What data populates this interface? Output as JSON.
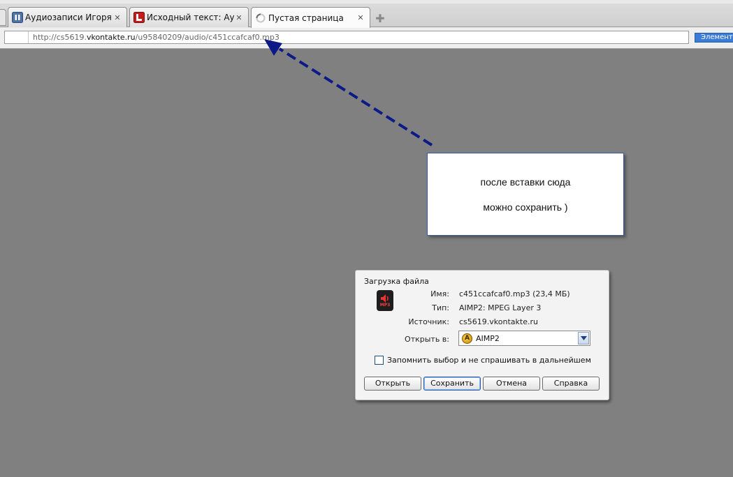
{
  "browser": {
    "tabs": [
      {
        "title": "Аудиозаписи Игоря Пр…",
        "icon": "vk-audio-icon",
        "close": "✕"
      },
      {
        "title": "Исходный текст: Ауди…",
        "icon": "liveinternet-icon",
        "close": "✕"
      },
      {
        "title": "Пустая страница",
        "icon": "loading-spinner-icon",
        "close": "✕"
      }
    ],
    "new_tab": "✚",
    "address": {
      "prefix": "http://cs5619.",
      "domain": "vkontakte.ru",
      "path": "/u95840209/audio/c451ccafcaf0.mp3"
    },
    "panel_button": "Элементы"
  },
  "annotation": {
    "line1": "после вставки сюда",
    "line2": "можно сохранить )",
    "arrow_color": "#0b1a86"
  },
  "dialog": {
    "title": "Загрузка файла",
    "file_icon_label": "MP3",
    "name_label": "Имя:",
    "name_value": "c451ccafcaf0.mp3 (23,4 МБ)",
    "type_label": "Тип:",
    "type_value": "AIMP2: MPEG Layer 3",
    "source_label": "Источник:",
    "source_value": "cs5619.vkontakte.ru",
    "open_with_label": "Открыть в:",
    "open_with_value": "AIMP2",
    "open_with_app_glyph": "A",
    "remember_label": "Запомнить выбор и не спрашивать в дальнейшем",
    "remember_checked": false,
    "buttons": {
      "open": "Открыть",
      "save": "Сохранить",
      "cancel": "Отмена",
      "help": "Справка"
    }
  },
  "colors": {
    "workspace": "#808080",
    "selected_button_border": "#2b5ea8"
  }
}
